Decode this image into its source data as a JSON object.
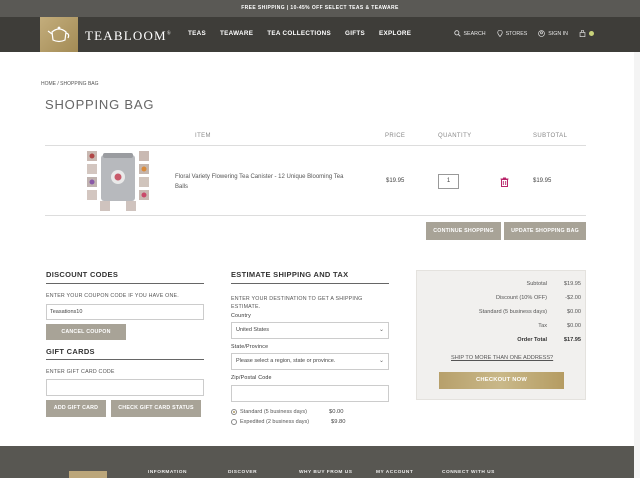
{
  "promo": "FREE SHIPPING | 10-45% OFF SELECT TEAS & TEAWARE",
  "brand": "TEABLOOM",
  "brand_mark": "®",
  "menu": [
    "TEAS",
    "TEAWARE",
    "TEA COLLECTIONS",
    "GIFTS",
    "EXPLORE"
  ],
  "utils": {
    "search": "SEARCH",
    "stores": "STORES",
    "signin": "SIGN IN"
  },
  "breadcrumb": "HOME / SHOPPING BAG",
  "page_title": "SHOPPING BAG",
  "table": {
    "headers": {
      "item": "ITEM",
      "price": "PRICE",
      "quantity": "QUANTITY",
      "subtotal": "SUBTOTAL"
    },
    "rows": [
      {
        "name": "Floral Variety Flowering Tea Canister - 12 Unique Blooming Tea Balls",
        "price": "$19.95",
        "qty": "1",
        "subtotal": "$19.95"
      }
    ]
  },
  "buttons": {
    "continue": "CONTINUE SHOPPING",
    "update": "UPDATE SHOPPING BAG"
  },
  "discount": {
    "title": "DISCOUNT CODES",
    "label": "ENTER YOUR COUPON CODE IF YOU HAVE ONE.",
    "value": "Teasations10",
    "cancel": "CANCEL COUPON"
  },
  "gift": {
    "title": "GIFT CARDS",
    "label": "ENTER GIFT CARD CODE",
    "value": "",
    "add": "ADD GIFT CARD",
    "check": "CHECK GIFT CARD STATUS"
  },
  "shipping": {
    "title": "ESTIMATE SHIPPING AND TAX",
    "intro": "ENTER YOUR DESTINATION TO GET A SHIPPING ESTIMATE.",
    "country_label": "Country",
    "country_value": "United States",
    "state_label": "State/Province",
    "state_value": "Please select a region, state or province.",
    "zip_label": "Zip/Postal Code",
    "zip_value": "",
    "options": [
      {
        "label": "Standard (5 business days)",
        "price": "$0.00",
        "selected": true
      },
      {
        "label": "Expedited (2 business days)",
        "price": "$9.80",
        "selected": false
      }
    ]
  },
  "summary": {
    "rows": [
      {
        "k": "Subtotal",
        "v": "$19.95"
      },
      {
        "k": "Discount (10% OFF)",
        "v": "-$2.00"
      },
      {
        "k": "Standard (5 business days)",
        "v": "$0.00"
      },
      {
        "k": "Tax",
        "v": "$0.00"
      },
      {
        "k": "Order Total",
        "v": "$17.95"
      }
    ],
    "multi": "SHIP TO MORE THAN ONE ADDRESS?",
    "checkout": "CHECKOUT NOW"
  },
  "footer": [
    "INFORMATION",
    "DISCOVER",
    "WHY BUY FROM US",
    "MY ACCOUNT",
    "CONNECT WITH US"
  ],
  "colors": {
    "gold": "#b19a5f",
    "nav": "#3e3d39",
    "button": "#a8a397"
  }
}
